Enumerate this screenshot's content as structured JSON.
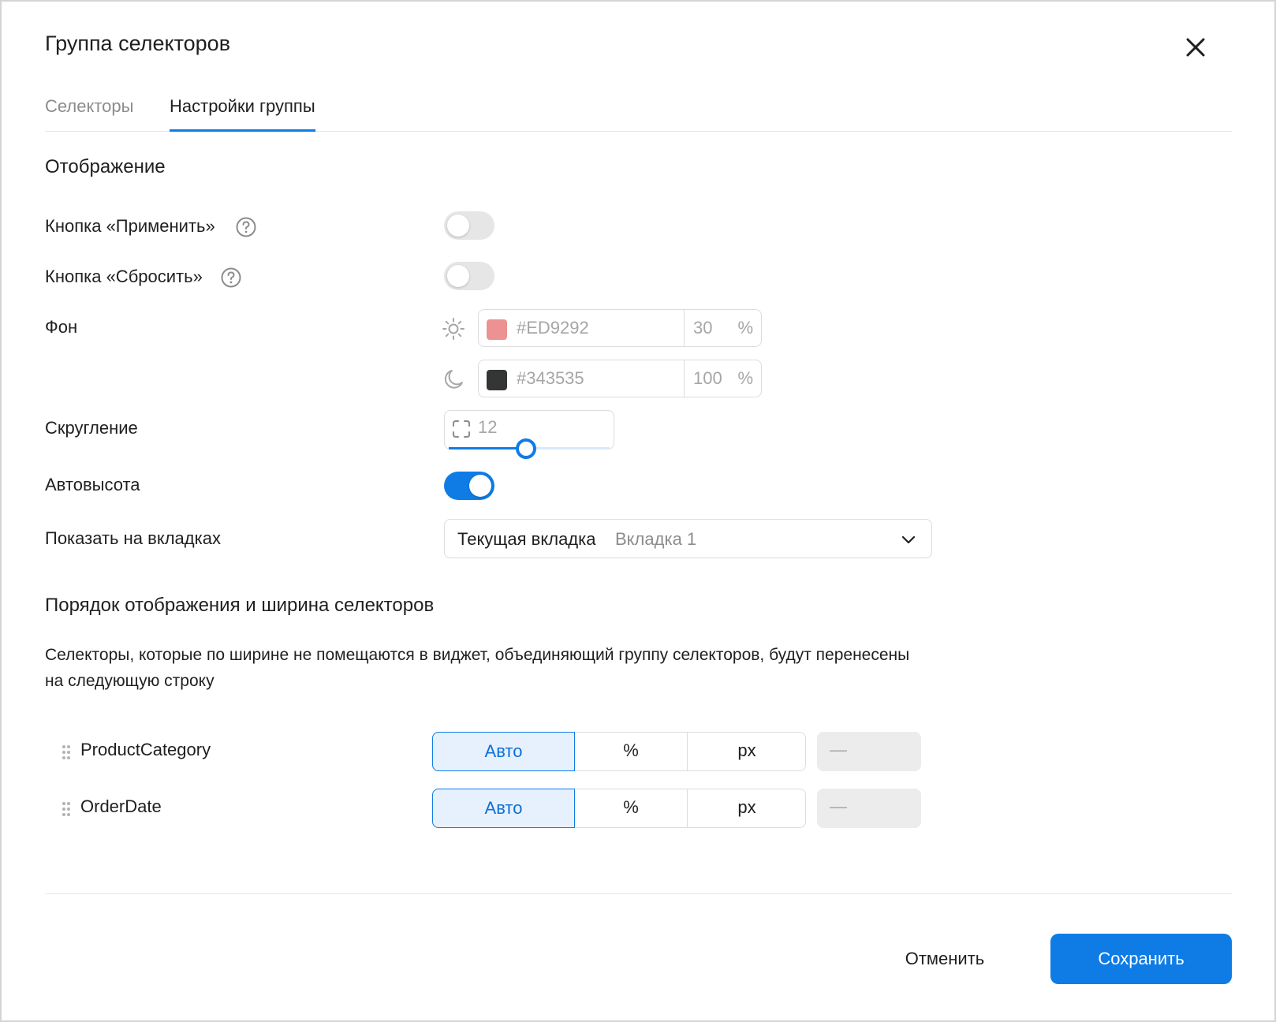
{
  "dialog": {
    "title": "Группа селекторов",
    "close_icon": "close-icon"
  },
  "tabs": [
    {
      "label": "Селекторы",
      "active": false
    },
    {
      "label": "Настройки группы",
      "active": true
    }
  ],
  "display": {
    "heading": "Отображение",
    "apply_button": {
      "label": "Кнопка «Применить»",
      "enabled": false,
      "icon": "help-icon"
    },
    "reset_button": {
      "label": "Кнопка «Сбросить»",
      "enabled": false,
      "icon": "help-icon"
    },
    "background": {
      "label": "Фон",
      "light": {
        "icon": "sun-icon",
        "swatch_color": "#ED9292",
        "hex": "#ED9292",
        "opacity": "30",
        "unit": "%"
      },
      "dark": {
        "icon": "moon-icon",
        "swatch_color": "#343535",
        "hex": "#343535",
        "opacity": "100",
        "unit": "%"
      }
    },
    "rounding": {
      "label": "Скругление",
      "icon": "corner-radius-icon",
      "value": "12",
      "slider_fraction": 0.48
    },
    "auto_height": {
      "label": "Автовысота",
      "enabled": true
    },
    "show_on_tabs": {
      "label": "Показать на вкладках",
      "select_label": "Текущая вкладка",
      "select_value": "Вкладка 1",
      "icon": "chevron-down-icon"
    }
  },
  "order": {
    "heading": "Порядок отображения и ширина селекторов",
    "description": "Селекторы, которые по ширине не помещаются в виджет, объединяющий группу селекторов, будут перенесены на следующую строку",
    "selectors": [
      {
        "name": "ProductCategory",
        "options": [
          "Авто",
          "%",
          "px"
        ],
        "selected": "Авто",
        "width_value": "—"
      },
      {
        "name": "OrderDate",
        "options": [
          "Авто",
          "%",
          "px"
        ],
        "selected": "Авто",
        "width_value": "—"
      }
    ]
  },
  "footer": {
    "cancel_label": "Отменить",
    "save_label": "Сохранить"
  },
  "colors": {
    "accent": "#0f7ce6",
    "toggle_off": "#e6e6e6"
  }
}
